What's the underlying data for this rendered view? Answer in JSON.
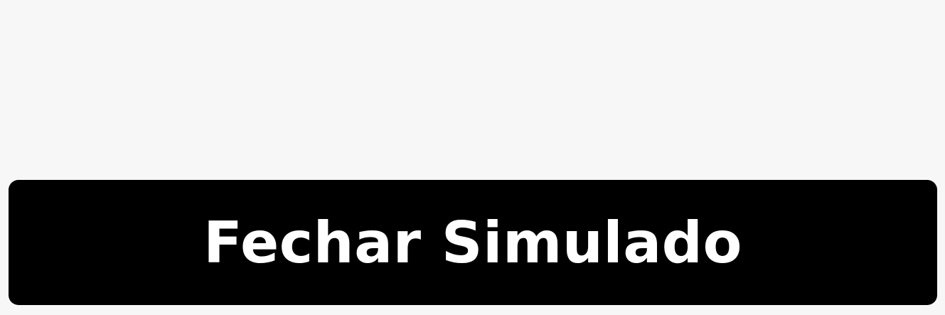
{
  "colors": {
    "page_background": "#f7f7f7",
    "button_background": "#000000",
    "button_text": "#ffffff"
  },
  "actions": {
    "close_button_label": "Fechar Simulado"
  }
}
